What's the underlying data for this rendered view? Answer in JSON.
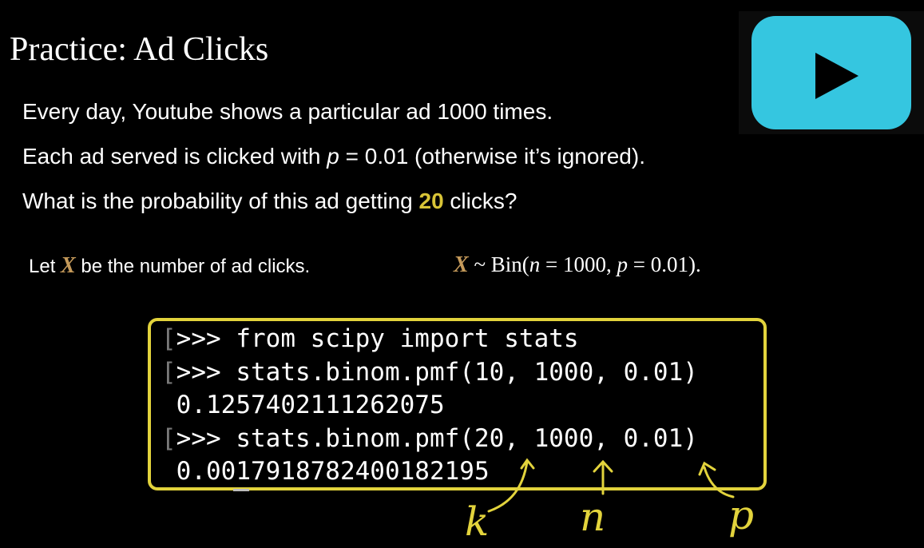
{
  "slide": {
    "title": "Practice: Ad Clicks"
  },
  "problem": {
    "line1": "Every day, Youtube shows a particular ad 1000 times.",
    "line2_before": "Each ad served is clicked with ",
    "line2_var": "p",
    "line2_after": " = 0.01 (otherwise it’s ignored).",
    "line3_before": "What is the probability of this ad getting ",
    "line3_highlight": "20",
    "line3_after": " clicks?"
  },
  "definition": {
    "let_before": "Let ",
    "variable": "X",
    "let_after": " be the number of ad clicks.",
    "dist_var": "X",
    "dist_tilde": " ~ Bin(",
    "dist_n": "n",
    "dist_n_val": " = 1000, ",
    "dist_p": "p",
    "dist_p_val": " = 0.01)."
  },
  "code": {
    "prompt_bracket": "[",
    "line1": ">>> from scipy import stats",
    "line2": ">>> stats.binom.pmf(10, 1000, 0.01)",
    "line3": "0.1257402111262075",
    "line4": ">>> stats.binom.pmf(20, 1000, 0.01)",
    "line5": "0.0017918782400182195"
  },
  "annotations": {
    "k": "k",
    "n": "n",
    "p": "p"
  },
  "colors": {
    "background": "#000000",
    "highlight": "#d8c437",
    "box_border": "#e2d33c",
    "variable": "#c59a5a",
    "youtube_button": "#35c6e0"
  },
  "icons": {
    "video": "youtube-play-icon"
  }
}
